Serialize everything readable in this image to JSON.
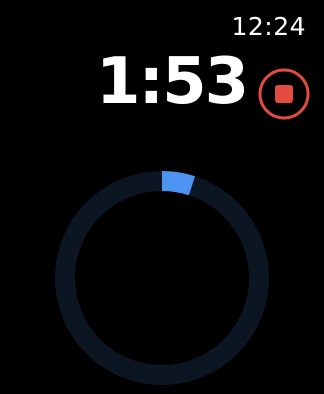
{
  "status_bar": {
    "time": "12:24"
  },
  "timer": {
    "display": "1:53"
  },
  "controls": {
    "stop_icon": "stop-circle-icon",
    "stop_color": "#e24b3f"
  },
  "progress_ring": {
    "fraction": 0.05,
    "track_color": "#0c1522",
    "fill_color": "#4c93f2"
  }
}
